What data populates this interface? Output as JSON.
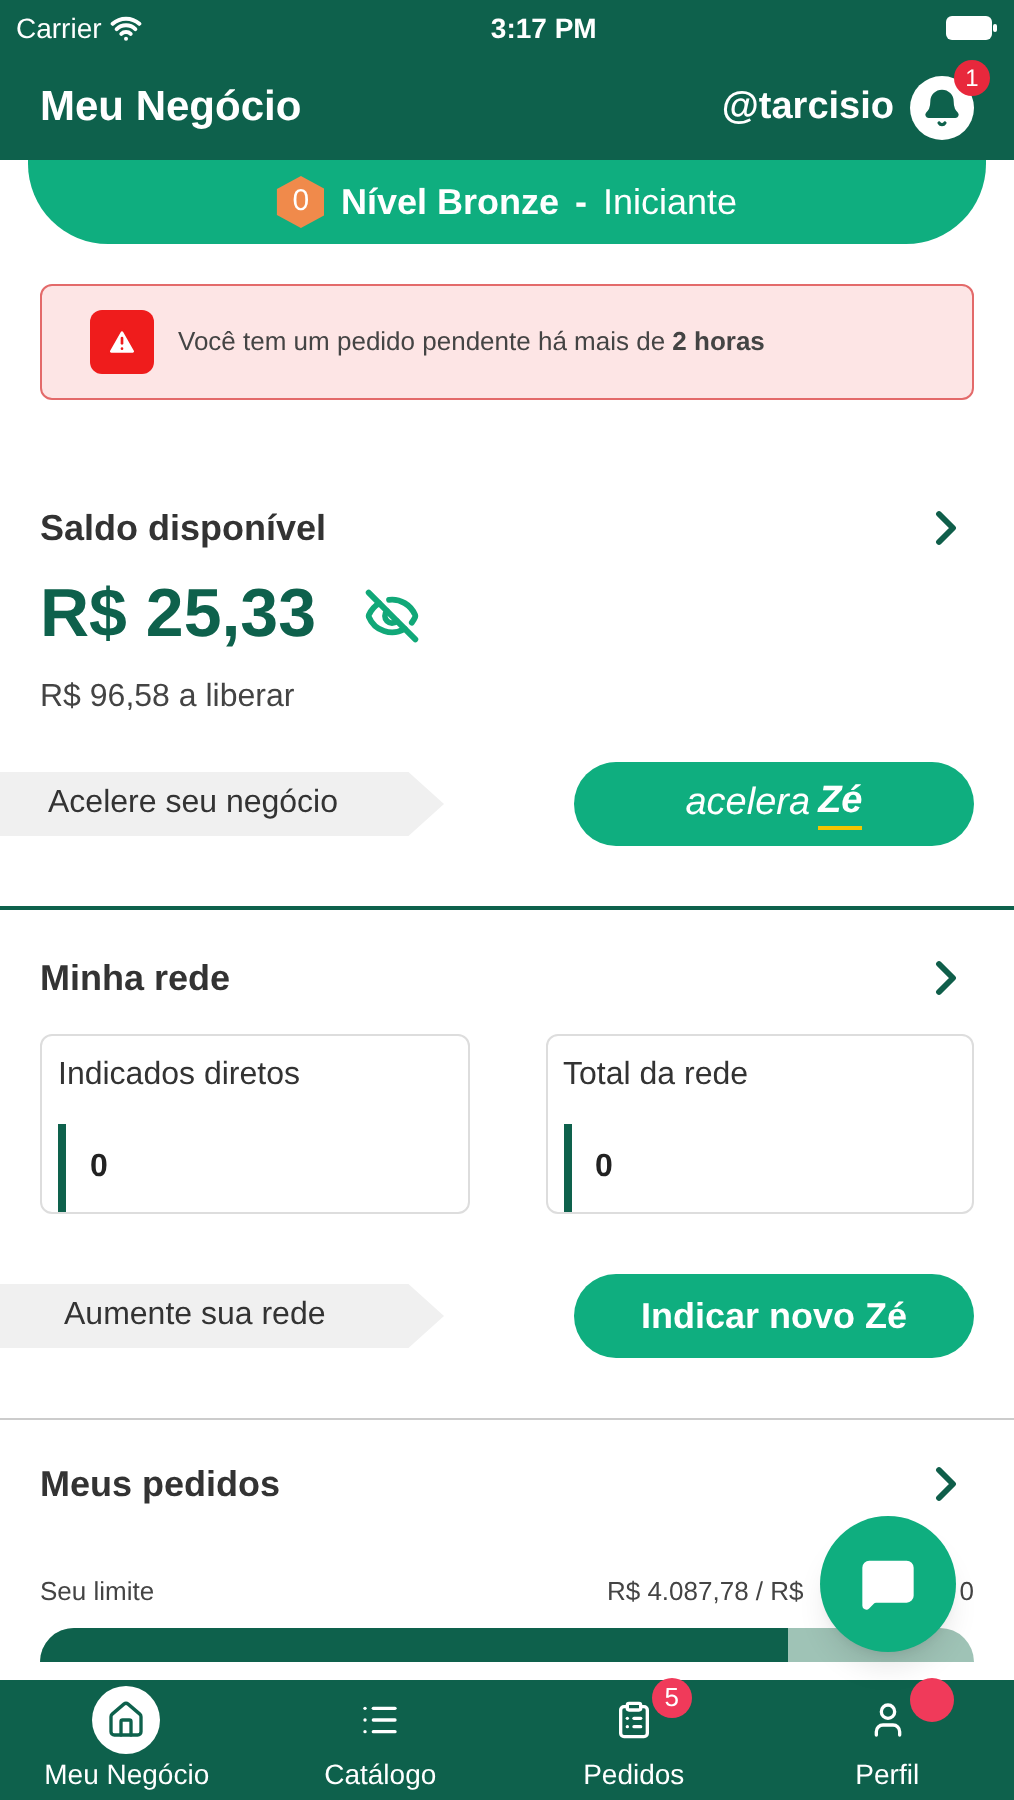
{
  "status_bar": {
    "carrier": "Carrier",
    "time": "3:17 PM"
  },
  "header": {
    "title": "Meu Negócio",
    "user": "@tarcisio",
    "notification_count": "1"
  },
  "level_banner": {
    "badge": "0",
    "level": "Nível Bronze",
    "separator": "-",
    "stage": "Iniciante"
  },
  "alert": {
    "text": "Você tem um pedido pendente há mais de **2 horas**"
  },
  "balance": {
    "title": "Saldo disponível",
    "amount": "R$ 25,33",
    "pending": "R$ 96,58 a liberar",
    "promo_label": "Acelere seu negócio",
    "promo_button": {
      "word": "acelera",
      "brand": "Zé"
    }
  },
  "network": {
    "title": "Minha rede",
    "cards": [
      {
        "label": "Indicados diretos",
        "value": "0"
      },
      {
        "label": "Total da rede",
        "value": "0"
      }
    ],
    "promo_label": "Aumente sua rede",
    "button": "Indicar novo Zé"
  },
  "orders": {
    "title": "Meus pedidos",
    "limit_label": "Seu limite",
    "limit_text": "R$ 4.087,78 / R$",
    "limit_tail": "0",
    "level": 0.8
  },
  "tab_bar": [
    {
      "label": "Meu Negócio",
      "selected": true
    },
    {
      "label": "Catálogo",
      "selected": false
    },
    {
      "label": "Pedidos",
      "selected": false,
      "badge": "5"
    },
    {
      "label": "Perfil",
      "selected": false,
      "dot": true
    }
  ]
}
